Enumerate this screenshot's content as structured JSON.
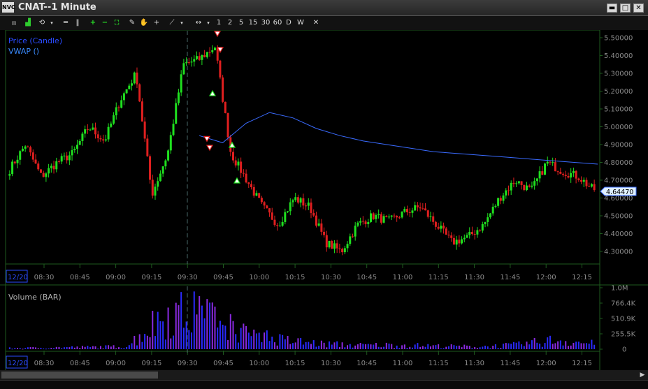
{
  "window": {
    "app_icon": "NVC",
    "title": "CNAT--1 Minute",
    "min_glyph": "▬",
    "max_glyph": "□",
    "close_glyph": "✕"
  },
  "toolbar": {
    "periods": [
      "1",
      "2",
      "5",
      "15",
      "30",
      "60",
      "D",
      "W"
    ],
    "close_glyph": "✕"
  },
  "price_panel": {
    "legend_price": "Price (Candle)",
    "legend_vwap": "VWAP ()",
    "last_price": "4.64470",
    "y_ticks": [
      "5.50000",
      "5.40000",
      "5.30000",
      "5.20000",
      "5.10000",
      "5.00000",
      "4.90000",
      "4.80000",
      "4.70000",
      "4.60000",
      "4.50000",
      "4.40000",
      "4.30000"
    ],
    "date_label": "12/20"
  },
  "volume_panel": {
    "legend": "Volume (BAR)",
    "y_ticks": [
      "1.0M",
      "766.4K",
      "510.9K",
      "255.5K",
      "0"
    ],
    "date_label": "12/20"
  },
  "x_ticks": [
    "08:30",
    "08:45",
    "09:00",
    "09:15",
    "09:30",
    "09:45",
    "10:00",
    "10:15",
    "10:30",
    "10:45",
    "11:00",
    "11:15",
    "11:30",
    "11:45",
    "12:00",
    "12:15"
  ],
  "colors": {
    "up": "#1fe01f",
    "down": "#e01f1f",
    "vwap": "#3a6bff",
    "volume": "#2a2aff",
    "volume_alt": "#8a2ae0",
    "grid": "#1e5a1e",
    "axis_text": "#8a8a8a",
    "legend_price": "#2a4bff",
    "legend_vwap": "#3a8bff"
  },
  "chart_data": [
    {
      "type": "candlestick",
      "title": "Price (Candle)",
      "ylim": [
        4.25,
        5.53
      ],
      "x": [
        "08:30",
        "08:45",
        "09:00",
        "09:15",
        "09:30",
        "09:45",
        "10:00",
        "10:15",
        "10:30",
        "10:45",
        "11:00",
        "11:15",
        "11:30",
        "11:45",
        "12:00",
        "12:15"
      ],
      "close_path": [
        4.76,
        4.9,
        4.72,
        4.8,
        4.85,
        5.0,
        4.92,
        5.15,
        5.3,
        4.62,
        4.85,
        5.35,
        5.38,
        5.45,
        4.85,
        4.7,
        4.55,
        4.45,
        4.6,
        4.55,
        4.35,
        4.3,
        4.45,
        4.5,
        4.47,
        4.52,
        4.55,
        4.45,
        4.35,
        4.38,
        4.45,
        4.6,
        4.7,
        4.64,
        4.8,
        4.75,
        4.72,
        4.64
      ],
      "vwap_path": [
        4.95,
        4.91,
        5.02,
        5.08,
        5.05,
        4.99,
        4.95,
        4.92,
        4.9,
        4.88,
        4.86,
        4.85,
        4.84,
        4.83,
        4.82,
        4.81,
        4.8,
        4.79
      ],
      "last_price": 4.6447
    },
    {
      "type": "bar",
      "title": "Volume (BAR)",
      "ylim": [
        0,
        1000000
      ],
      "x": [
        "08:30",
        "08:45",
        "09:00",
        "09:15",
        "09:30",
        "09:45",
        "10:00",
        "10:15",
        "10:30",
        "10:45",
        "11:00",
        "11:15",
        "11:30",
        "11:45",
        "12:00",
        "12:15"
      ],
      "peak_values": [
        30000,
        45000,
        60000,
        75000,
        1000000,
        950000,
        420000,
        250000,
        150000,
        110000,
        120000,
        90000,
        70000,
        120000,
        260000,
        150000
      ]
    }
  ]
}
